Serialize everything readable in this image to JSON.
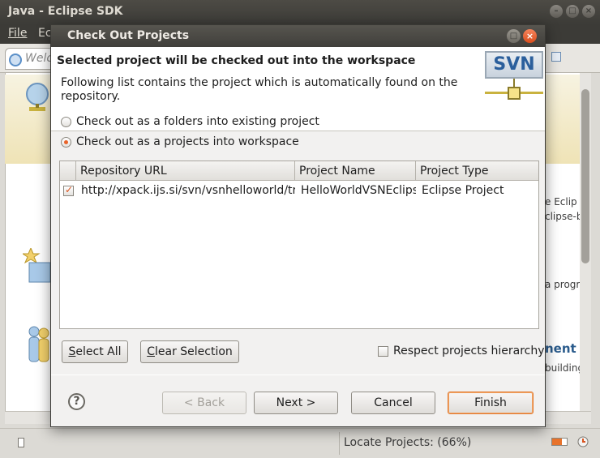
{
  "window": {
    "title": "Java - Eclipse SDK",
    "menu": {
      "file": "File",
      "edit_partial": "Ec"
    },
    "welcome_tab_partial": "Welc",
    "background_text": {
      "line1": "e Eclip",
      "line2": "clipse-b",
      "line3": "a progr",
      "heading": "nent",
      "line4": "building"
    },
    "status": {
      "text": "Locate Projects: (66%)",
      "progress_percent": 66
    }
  },
  "dialog": {
    "title": "Check Out Projects",
    "header_title": "Selected project will be checked out into the workspace",
    "header_description": "Following list contains the project which is automatically found on the repository.",
    "logo_text": "SVN",
    "radio_options": [
      {
        "label": "Check out as a folders into existing project",
        "checked": false
      },
      {
        "label": "Check out as a projects into workspace",
        "checked": true
      }
    ],
    "table": {
      "columns": [
        "Repository URL",
        "Project Name",
        "Project Type"
      ],
      "rows": [
        {
          "checked": true,
          "url": "http://xpack.ijs.si/svn/vsnhelloworld/tr",
          "name": "HelloWorldVSNEclips",
          "type": "Eclipse Project"
        }
      ]
    },
    "buttons": {
      "select_all": "Select All",
      "clear_selection": "Clear Selection",
      "back": "< Back",
      "next": "Next >",
      "cancel": "Cancel",
      "finish": "Finish"
    },
    "respect_hierarchy": {
      "label": "Respect projects hierarchy",
      "checked": false
    },
    "help_symbol": "?"
  },
  "colors": {
    "accent": "#e8632a",
    "titlebar": "#3c3b37",
    "link_heading": "#2a5b8c"
  }
}
